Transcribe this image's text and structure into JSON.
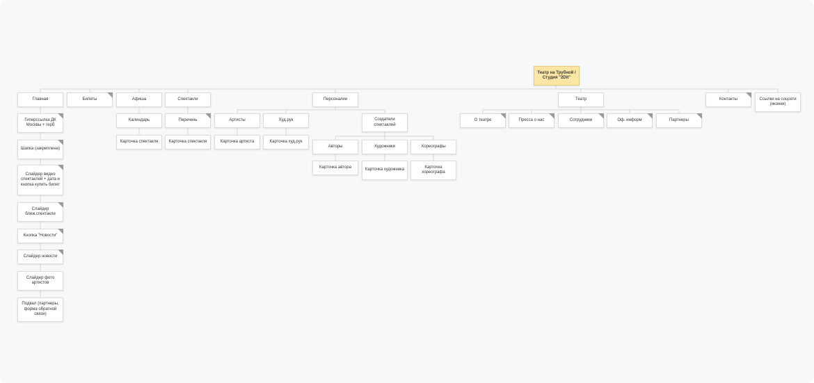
{
  "diagram": {
    "root": "Театр на Трубной / Студия \"2Dit\"",
    "nodes": {
      "glavnaya": "Главная",
      "gl_1": "Гиперссылка ДК Москвы + герб",
      "gl_2": "Шапка (закреплена)",
      "gl_3": "Слайдер видео спектаклей + дата и кнопка купить билет",
      "gl_4": "Слайдер ближ.спектакли",
      "gl_5": "Кнопка \"Новости\"",
      "gl_6": "Слайдер новости",
      "gl_7": "Слайдер фото артистов",
      "gl_8": "Подвал (партнеры, форма обратной связи)",
      "bilety": "Билеты",
      "afisha": "Афиша",
      "kalendar": "Календарь",
      "kartochka_sp1": "Карточка спектакля",
      "spektakli": "Спектакли",
      "perechen": "Перечень",
      "kartochka_sp2": "Карточка спектакля",
      "personalii": "Персоналии",
      "artisty": "Артисты",
      "kartochka_art": "Карточка артиста",
      "hud_ruk": "Худ.рук",
      "kartochka_hud_ruk": "Карточка худ.рук",
      "sozdateli": "Создатели спектаклей",
      "avtory": "Авторы",
      "kartochka_avt": "Карточка автора",
      "hudozhniki": "Художники",
      "kartochka_hudozh": "Карточка художника",
      "horeografy": "Хореографы",
      "kartochka_hor": "Карточка хореографа",
      "teatr": "Театр",
      "o_teatre": "О театре",
      "pressa": "Пресса о нас",
      "sotrudniki": "Сотрудники",
      "of_inform": "Оф. информ",
      "partnery": "Партнеры",
      "kontakty": "Контакты",
      "ssylki": "Ссылки на соцсети (иконки)"
    }
  },
  "colors": {
    "root_fill": "#fbe6a6",
    "node_fill": "#ffffff",
    "connector": "#d6d6d6",
    "canvas": "#f7f8fa"
  }
}
